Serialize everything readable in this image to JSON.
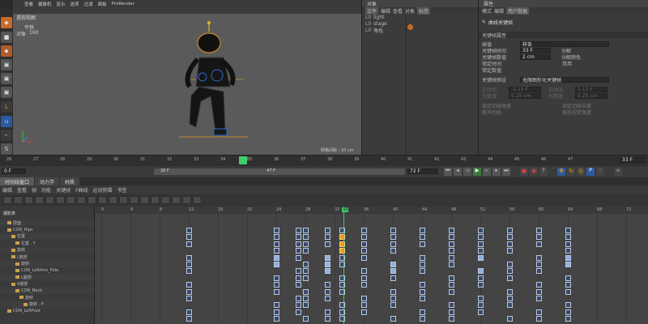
{
  "menubar": [
    "查看",
    "摄像机",
    "显示",
    "选项",
    "过滤",
    "面板",
    "ProRender"
  ],
  "viewport": {
    "label": "透视视图",
    "opt_a": "平移",
    "opt_b": "对象",
    "opt_b_val": "160",
    "grid_label": "网格间距 : 10 cm"
  },
  "objects": {
    "title": "对象",
    "menu": [
      "文件",
      "编辑",
      "查看",
      "对象",
      "标签"
    ],
    "items": [
      {
        "name": "light"
      },
      {
        "name": "stage"
      },
      {
        "name": "角色"
      }
    ]
  },
  "attributes": {
    "title": "属性",
    "menu": [
      "模式",
      "编辑",
      "用户数据"
    ],
    "section": "曲线关键帧",
    "group": "关键帧属性",
    "rows": [
      {
        "label": "插值",
        "value": "样条"
      },
      {
        "label": "关键帧时间",
        "value": "33 F",
        "label2": "分解"
      },
      {
        "label": "关键帧数值",
        "value": "2 cm",
        "label2": "分解颜色"
      },
      {
        "label": "锁定时间",
        "label2": "禁用"
      },
      {
        "label": "锁定数值"
      }
    ],
    "preset_label": "关键帧预设",
    "preset_value": "无限图形化关键帧",
    "greyed": [
      {
        "label": "左时间",
        "value": "-1.13 F",
        "label2": "右时间",
        "value2": "1.13 F"
      },
      {
        "label": "左数值",
        "value": "0.25 cm",
        "label2": "右数值",
        "value2": "0.25 cm"
      }
    ],
    "locks": [
      {
        "label": "锁定切线角度",
        "label2": "锁定切线长度"
      },
      {
        "label": "断开切线",
        "label2": "保持视觉角度"
      }
    ]
  },
  "timeline": {
    "ticks": [
      "26",
      "27",
      "28",
      "29",
      "30",
      "31",
      "32",
      "33",
      "34",
      "35",
      "36",
      "37",
      "38",
      "39",
      "40",
      "41",
      "42",
      "43",
      "44",
      "45",
      "46",
      "47"
    ],
    "current": "33",
    "end_field": "33 F"
  },
  "transport": {
    "start": "0 F",
    "range_start": "26 F",
    "range_end": "47 F",
    "end": "72 F"
  },
  "tabs": [
    "时间线窗口",
    "动力学",
    "材质"
  ],
  "tlmenu": [
    "编辑",
    "查看",
    "帧",
    "功能",
    "关键帧",
    "F曲线",
    "运动剪辑",
    "书签"
  ],
  "tree": {
    "title": "摄影表",
    "items": [
      {
        "label": "层面",
        "indent": 1
      },
      {
        "label": "CON_Hips",
        "indent": 1
      },
      {
        "label": "位置",
        "indent": 2
      },
      {
        "label": "位置 . Y",
        "indent": 3
      },
      {
        "label": "旋转",
        "indent": 2
      },
      {
        "label": "L髋部",
        "indent": 2
      },
      {
        "label": "旋转",
        "indent": 3
      },
      {
        "label": "CON_LeftArm_Pole",
        "indent": 3
      },
      {
        "label": "L腿部",
        "indent": 3
      },
      {
        "label": "R腿部",
        "indent": 2
      },
      {
        "label": "CON_Neck",
        "indent": 3
      },
      {
        "label": "旋转",
        "indent": 4
      },
      {
        "label": "旋转 . P",
        "indent": 5
      },
      {
        "label": "CON_LeftFoot",
        "indent": 1
      }
    ]
  },
  "graph": {
    "ticks": [
      "0",
      "4",
      "8",
      "12",
      "16",
      "20",
      "24",
      "28",
      "32",
      "33",
      "36",
      "40",
      "44",
      "48",
      "52",
      "56",
      "60",
      "64",
      "68",
      "72"
    ],
    "current": "33"
  },
  "colors": {
    "accent": "#4a90d9",
    "playhead": "#3ecf6a",
    "key_selected": "#e8a020"
  }
}
